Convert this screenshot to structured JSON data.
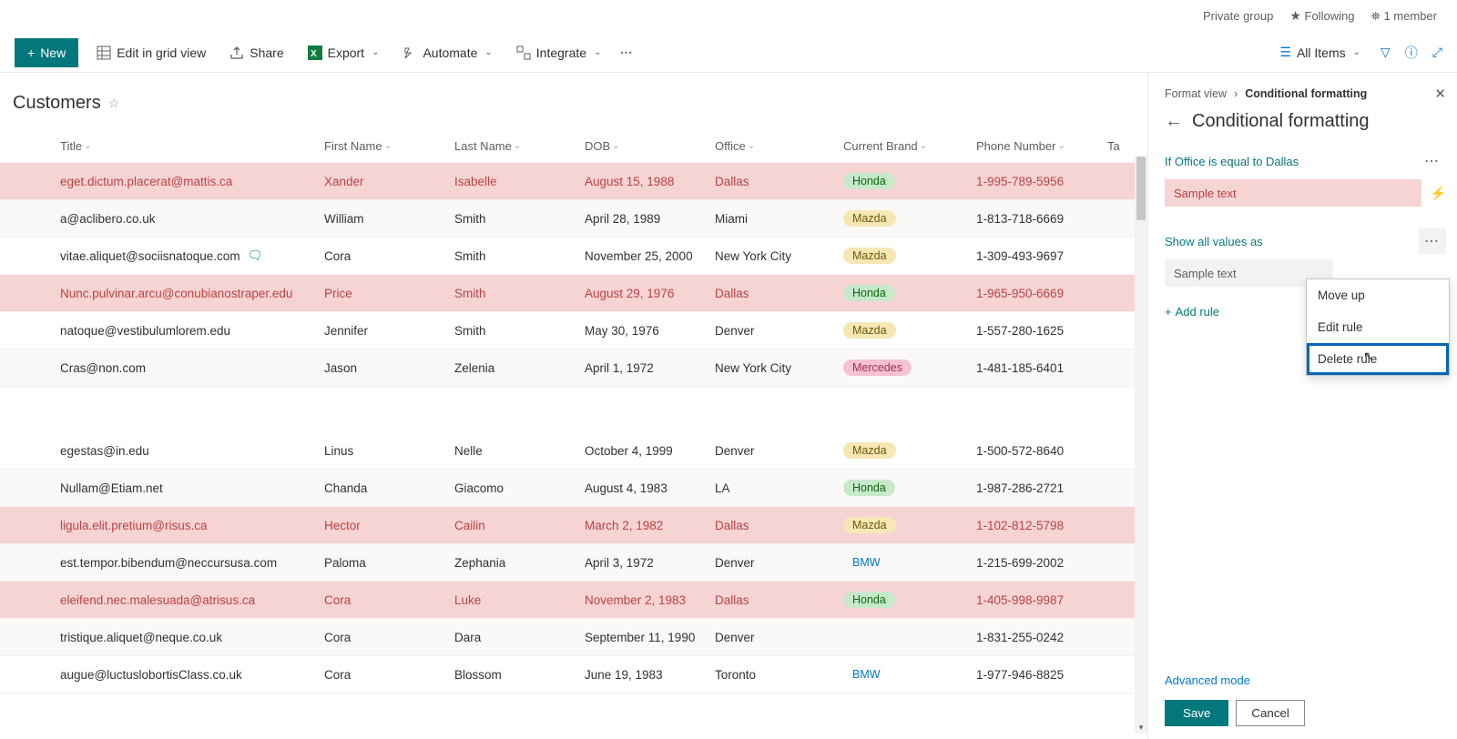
{
  "topbar": {
    "group": "Private group",
    "follow": "Following",
    "members": "1 member"
  },
  "cmd": {
    "new": "New",
    "gridview": "Edit in grid view",
    "share": "Share",
    "export": "Export",
    "automate": "Automate",
    "integrate": "Integrate",
    "allitems": "All Items"
  },
  "list": {
    "title": "Customers"
  },
  "columns": {
    "title": "Title",
    "first": "First Name",
    "last": "Last Name",
    "dob": "DOB",
    "office": "Office",
    "brand": "Current Brand",
    "phone": "Phone Number",
    "ta": "Ta"
  },
  "rows": [
    {
      "hl": true,
      "title": "eget.dictum.placerat@mattis.ca",
      "first": "Xander",
      "last": "Isabelle",
      "dob": "August 15, 1988",
      "office": "Dallas",
      "brand": "Honda",
      "brand_pill": "green",
      "phone": "1-995-789-5956"
    },
    {
      "title": "a@aclibero.co.uk",
      "first": "William",
      "last": "Smith",
      "dob": "April 28, 1989",
      "office": "Miami",
      "brand": "Mazda",
      "brand_pill": "yellow",
      "phone": "1-813-718-6669"
    },
    {
      "title": "vitae.aliquet@sociisnatoque.com",
      "comment": true,
      "first": "Cora",
      "last": "Smith",
      "dob": "November 25, 2000",
      "office": "New York City",
      "brand": "Mazda",
      "brand_pill": "yellow",
      "phone": "1-309-493-9697"
    },
    {
      "hl": true,
      "title": "Nunc.pulvinar.arcu@conubianostraper.edu",
      "first": "Price",
      "last": "Smith",
      "dob": "August 29, 1976",
      "office": "Dallas",
      "brand": "Honda",
      "brand_pill": "green",
      "phone": "1-965-950-6669"
    },
    {
      "title": "natoque@vestibulumlorem.edu",
      "first": "Jennifer",
      "last": "Smith",
      "dob": "May 30, 1976",
      "office": "Denver",
      "brand": "Mazda",
      "brand_pill": "yellow",
      "phone": "1-557-280-1625"
    },
    {
      "title": "Cras@non.com",
      "first": "Jason",
      "last": "Zelenia",
      "dob": "April 1, 1972",
      "office": "New York City",
      "brand": "Mercedes",
      "brand_pill": "pink",
      "phone": "1-481-185-6401"
    },
    {
      "gap": true
    },
    {
      "title": "egestas@in.edu",
      "first": "Linus",
      "last": "Nelle",
      "dob": "October 4, 1999",
      "office": "Denver",
      "brand": "Mazda",
      "brand_pill": "yellow",
      "phone": "1-500-572-8640"
    },
    {
      "title": "Nullam@Etiam.net",
      "first": "Chanda",
      "last": "Giacomo",
      "dob": "August 4, 1983",
      "office": "LA",
      "brand": "Honda",
      "brand_pill": "green",
      "phone": "1-987-286-2721"
    },
    {
      "hl": true,
      "title": "ligula.elit.pretium@risus.ca",
      "first": "Hector",
      "last": "Cailin",
      "dob": "March 2, 1982",
      "office": "Dallas",
      "brand": "Mazda",
      "brand_pill": "yellow",
      "phone": "1-102-812-5798"
    },
    {
      "title": "est.tempor.bibendum@neccursusa.com",
      "first": "Paloma",
      "last": "Zephania",
      "dob": "April 3, 1972",
      "office": "Denver",
      "brand": "BMW",
      "brand_pill": "blue",
      "phone": "1-215-699-2002"
    },
    {
      "hl": true,
      "title": "eleifend.nec.malesuada@atrisus.ca",
      "first": "Cora",
      "last": "Luke",
      "dob": "November 2, 1983",
      "office": "Dallas",
      "brand": "Honda",
      "brand_pill": "green",
      "phone": "1-405-998-9987"
    },
    {
      "title": "tristique.aliquet@neque.co.uk",
      "first": "Cora",
      "last": "Dara",
      "dob": "September 11, 1990",
      "office": "Denver",
      "brand": "",
      "brand_pill": "",
      "phone": "1-831-255-0242"
    },
    {
      "title": "augue@luctuslobortisClass.co.uk",
      "first": "Cora",
      "last": "Blossom",
      "dob": "June 19, 1983",
      "office": "Toronto",
      "brand": "BMW",
      "brand_pill": "blue",
      "phone": "1-977-946-8825"
    }
  ],
  "panel": {
    "crumb_format": "Format view",
    "crumb_cur": "Conditional formatting",
    "title": "Conditional formatting",
    "rule1": "If Office is equal to Dallas",
    "sample": "Sample text",
    "rule2": "Show all values as",
    "addrule": "Add rule",
    "adv": "Advanced mode",
    "save": "Save",
    "cancel": "Cancel",
    "ctx": {
      "moveup": "Move up",
      "edit": "Edit rule",
      "delete": "Delete rule"
    }
  }
}
